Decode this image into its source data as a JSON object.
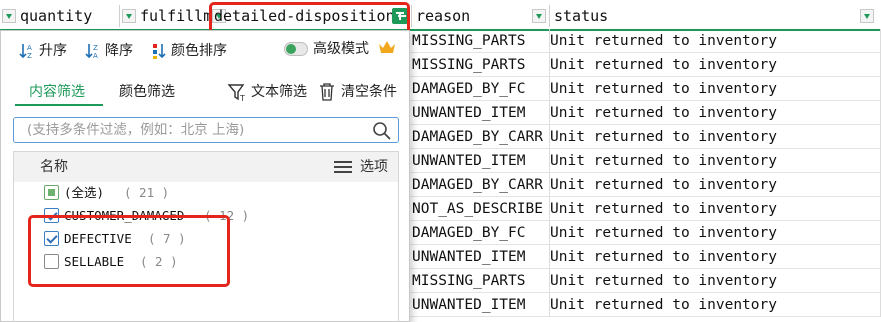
{
  "columns": [
    {
      "label": "quantity"
    },
    {
      "label": "fulfillm"
    },
    {
      "label": "detailed-disposition"
    },
    {
      "label": "reason"
    },
    {
      "label": "status"
    }
  ],
  "rows": [
    {
      "reason": "MISSING_PARTS",
      "status": "Unit returned to inventory"
    },
    {
      "reason": "MISSING_PARTS",
      "status": "Unit returned to inventory"
    },
    {
      "reason": "DAMAGED_BY_FC",
      "status": "Unit returned to inventory"
    },
    {
      "reason": "UNWANTED_ITEM",
      "status": "Unit returned to inventory"
    },
    {
      "reason": "DAMAGED_BY_CARR",
      "status": "Unit returned to inventory"
    },
    {
      "reason": "UNWANTED_ITEM",
      "status": "Unit returned to inventory"
    },
    {
      "reason": "DAMAGED_BY_CARR",
      "status": "Unit returned to inventory"
    },
    {
      "reason": "NOT_AS_DESCRIBE",
      "status": "Unit returned to inventory"
    },
    {
      "reason": "DAMAGED_BY_FC",
      "status": "Unit returned to inventory"
    },
    {
      "reason": "UNWANTED_ITEM",
      "status": "Unit returned to inventory"
    },
    {
      "reason": "MISSING_PARTS",
      "status": "Unit returned to inventory"
    },
    {
      "reason": "UNWANTED_ITEM",
      "status": "Unit returned to inventory"
    }
  ],
  "panel": {
    "sort_asc": "升序",
    "sort_desc": "降序",
    "sort_color": "颜色排序",
    "advanced_mode": "高级模式",
    "tab_content": "内容筛选",
    "tab_color": "颜色筛选",
    "text_filter": "文本筛选",
    "clear": "清空条件",
    "search_placeholder": "(支持多条件过滤，例如：北京 上海)",
    "list_header_name": "名称",
    "list_header_options": "选项",
    "items": [
      {
        "label": "(全选)",
        "count": "( 21 )",
        "state": "partial"
      },
      {
        "label": "CUSTOMER_DAMAGED",
        "count": "( 12 )",
        "state": "checked"
      },
      {
        "label": "DEFECTIVE",
        "count": "( 7 )",
        "state": "checked"
      },
      {
        "label": "SELLABLE",
        "count": "( 2 )",
        "state": "unchecked"
      }
    ]
  },
  "colors": {
    "accent": "#1d9a5a",
    "highlight": "#e3251b",
    "focus": "#5b9bd5"
  }
}
